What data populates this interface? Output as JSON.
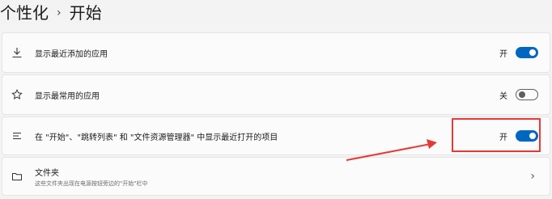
{
  "breadcrumb": {
    "parent": "个性化",
    "separator": "›",
    "current": "开始"
  },
  "rows": [
    {
      "label": "显示最近添加的应用",
      "state": "开",
      "toggle": "on",
      "icon": "download-icon"
    },
    {
      "label": "显示最常用的应用",
      "state": "关",
      "toggle": "off",
      "icon": "star-icon"
    },
    {
      "label": "在 \"开始\"、\"跳转列表\" 和 \"文件资源管理器\" 中显示最近打开的项目",
      "state": "开",
      "toggle": "on",
      "icon": "list-icon"
    },
    {
      "label": "文件夹",
      "sublabel": "这些文件夹出现在电源按钮旁边的\"开始\"栏中",
      "icon": "folder-icon"
    }
  ],
  "accent": "#0067c0",
  "annotation_color": "#e53935"
}
